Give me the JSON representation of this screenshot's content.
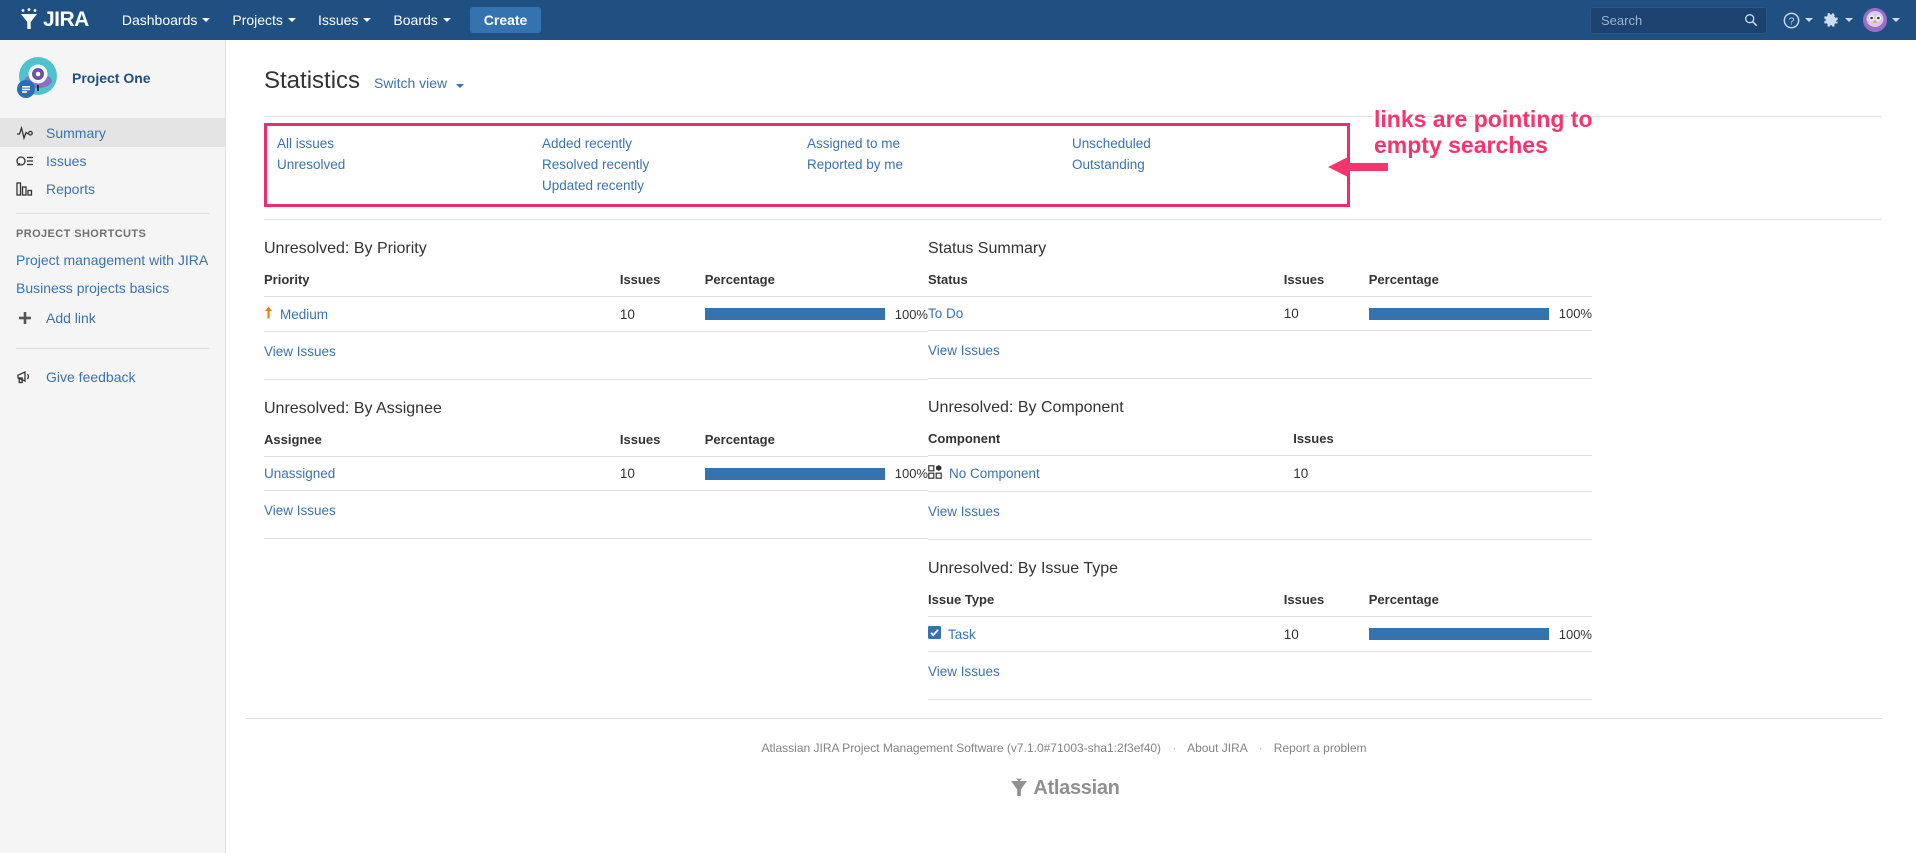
{
  "topnav": {
    "logo_text": "JIRA",
    "items": [
      {
        "label": "Dashboards",
        "icon": "chevron-down-icon"
      },
      {
        "label": "Projects",
        "icon": "chevron-down-icon"
      },
      {
        "label": "Issues",
        "icon": "chevron-down-icon"
      },
      {
        "label": "Boards",
        "icon": "chevron-down-icon"
      }
    ],
    "create_label": "Create",
    "search_placeholder": "Search",
    "search_value": "",
    "help_icon": "help-icon",
    "settings_icon": "gear-icon",
    "avatar_icon": "user-avatar"
  },
  "sidebar": {
    "project_name": "Project One",
    "nav_items": [
      {
        "label": "Summary",
        "icon": "activity-icon",
        "selected": true
      },
      {
        "label": "Issues",
        "icon": "issues-search-icon",
        "selected": false
      },
      {
        "label": "Reports",
        "icon": "bar-chart-icon",
        "selected": false
      }
    ],
    "shortcuts_label": "PROJECT SHORTCUTS",
    "shortcuts": [
      "Project management with JIRA",
      "Business projects basics"
    ],
    "add_link_label": "Add link",
    "feedback_label": "Give feedback"
  },
  "page": {
    "title": "Statistics",
    "switch_view_label": "Switch view",
    "annotation": "links are pointing to empty searches",
    "annotation_color": "#f4356e",
    "highlight_color": "#ed2e6e"
  },
  "filter_links": {
    "columns": [
      [
        "All issues",
        "Unresolved"
      ],
      [
        "Added recently",
        "Resolved recently",
        "Updated recently"
      ],
      [
        "Assigned to me",
        "Reported by me"
      ],
      [
        "Unscheduled",
        "Outstanding"
      ]
    ]
  },
  "reports": {
    "view_issues_label": "View Issues",
    "left": [
      {
        "title": "Unresolved: By Priority",
        "headers": [
          "Priority",
          "Issues",
          "Percentage"
        ],
        "rows": [
          {
            "name": "Medium",
            "icon": "priority-medium-arrow-icon",
            "issues": "10",
            "percentage": "100%",
            "pct_value": 100
          }
        ]
      },
      {
        "title": "Unresolved: By Assignee",
        "headers": [
          "Assignee",
          "Issues",
          "Percentage"
        ],
        "rows": [
          {
            "name": "Unassigned",
            "icon": "",
            "issues": "10",
            "percentage": "100%",
            "pct_value": 100
          }
        ]
      }
    ],
    "right": [
      {
        "title": "Status Summary",
        "headers": [
          "Status",
          "Issues",
          "Percentage"
        ],
        "rows": [
          {
            "name": "To Do",
            "icon": "",
            "issues": "10",
            "percentage": "100%",
            "pct_value": 100
          }
        ]
      },
      {
        "title": "Unresolved: By Component",
        "headers": [
          "Component",
          "Issues",
          ""
        ],
        "rows": [
          {
            "name": "No Component",
            "icon": "component-icon",
            "issues": "10",
            "percentage": "",
            "pct_value": null
          }
        ]
      },
      {
        "title": "Unresolved: By Issue Type",
        "headers": [
          "Issue Type",
          "Issues",
          "Percentage"
        ],
        "rows": [
          {
            "name": "Task",
            "icon": "task-checkbox-icon",
            "issues": "10",
            "percentage": "100%",
            "pct_value": 100
          }
        ]
      }
    ]
  },
  "footer": {
    "product": "Atlassian JIRA Project Management Software (v7.1.0#71003-sha1:2f3ef40)",
    "about_label": "About JIRA",
    "report_label": "Report a problem",
    "brand": "Atlassian"
  }
}
